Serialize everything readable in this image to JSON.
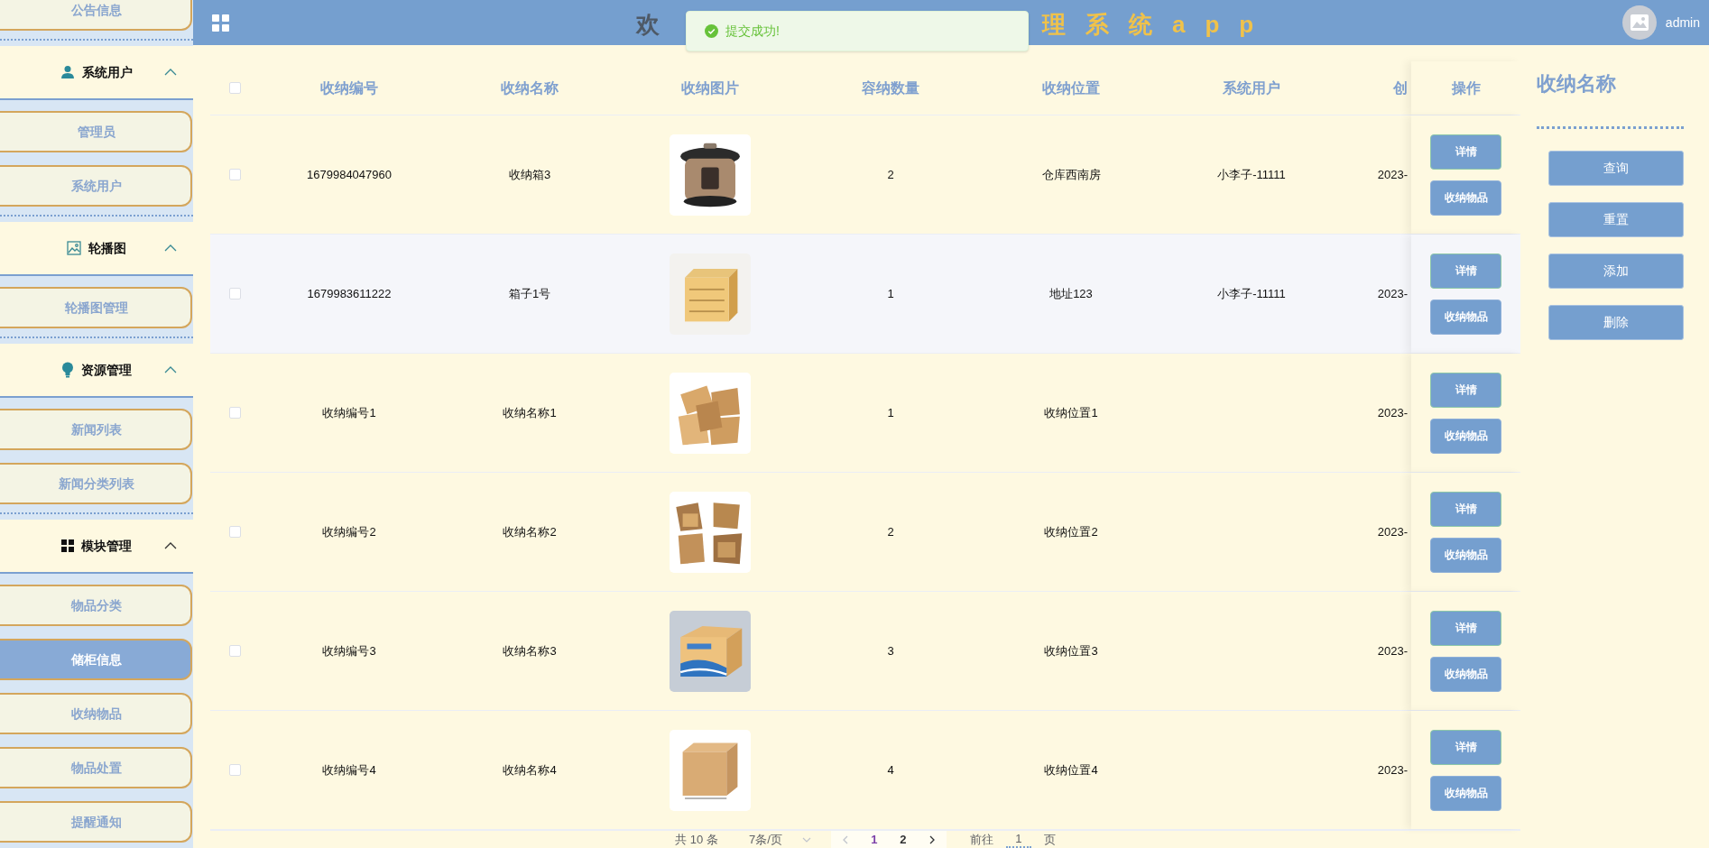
{
  "header": {
    "title_start": "欢",
    "title_end": "理系统app",
    "user": "admin"
  },
  "toast": {
    "message": "提交成功!"
  },
  "sidebar": {
    "top_item": {
      "label": "公告信息",
      "selected": false
    },
    "groups": [
      {
        "label": "系统用户",
        "expanded": true,
        "items": [
          {
            "label": "管理员",
            "selected": false
          },
          {
            "label": "系统用户",
            "selected": false
          }
        ]
      },
      {
        "label": "轮播图",
        "expanded": true,
        "items": [
          {
            "label": "轮播图管理",
            "selected": false
          }
        ]
      },
      {
        "label": "资源管理",
        "expanded": true,
        "items": [
          {
            "label": "新闻列表",
            "selected": false
          },
          {
            "label": "新闻分类列表",
            "selected": false
          }
        ]
      },
      {
        "label": "模块管理",
        "expanded": true,
        "items": [
          {
            "label": "物品分类",
            "selected": false
          },
          {
            "label": "储柜信息",
            "selected": true
          },
          {
            "label": "收纳物品",
            "selected": false
          },
          {
            "label": "物品处置",
            "selected": false
          },
          {
            "label": "提醒通知",
            "selected": false
          }
        ]
      }
    ]
  },
  "table": {
    "all_checked": false,
    "columns": [
      "收纳编号",
      "收纳名称",
      "收纳图片",
      "容纳数量",
      "收纳位置",
      "系统用户",
      "创"
    ],
    "actions_column": "操作",
    "rows": [
      {
        "checked": false,
        "hovered": false,
        "code": "1679984047960",
        "name": "收纳箱3",
        "quantity": "2",
        "location": "仓库西南房",
        "user": "小李子-11111",
        "created": "2023-",
        "actions": [
          "详情",
          "收纳物品"
        ]
      },
      {
        "checked": false,
        "hovered": true,
        "code": "1679983611222",
        "name": "箱子1号",
        "quantity": "1",
        "location": "地址123",
        "user": "小李子-11111",
        "created": "2023-",
        "actions": [
          "详情",
          "收纳物品"
        ]
      },
      {
        "checked": false,
        "hovered": false,
        "code": "收纳编号1",
        "name": "收纳名称1",
        "quantity": "1",
        "location": "收纳位置1",
        "created": "2023-",
        "actions": [
          "详情",
          "收纳物品"
        ]
      },
      {
        "checked": false,
        "hovered": false,
        "code": "收纳编号2",
        "name": "收纳名称2",
        "quantity": "2",
        "location": "收纳位置2",
        "created": "2023-",
        "actions": [
          "详情",
          "收纳物品"
        ]
      },
      {
        "checked": false,
        "hovered": false,
        "code": "收纳编号3",
        "name": "收纳名称3",
        "quantity": "3",
        "location": "收纳位置3",
        "created": "2023-",
        "actions": [
          "详情",
          "收纳物品"
        ]
      },
      {
        "checked": false,
        "hovered": false,
        "code": "收纳编号4",
        "name": "收纳名称4",
        "quantity": "4",
        "location": "收纳位置4",
        "created": "2023-",
        "actions": [
          "详情",
          "收纳物品"
        ]
      }
    ]
  },
  "pagination": {
    "total": "共 10 条",
    "page_size": "7条/页",
    "pages": [
      {
        "label": "1",
        "selected": true
      },
      {
        "label": "2",
        "selected": false
      }
    ],
    "goto_label": "前往",
    "goto_value": "1",
    "goto_suffix": "页"
  },
  "search_panel": {
    "title": "收纳名称",
    "buttons": [
      "查询",
      "重置",
      "添加",
      "删除"
    ]
  }
}
